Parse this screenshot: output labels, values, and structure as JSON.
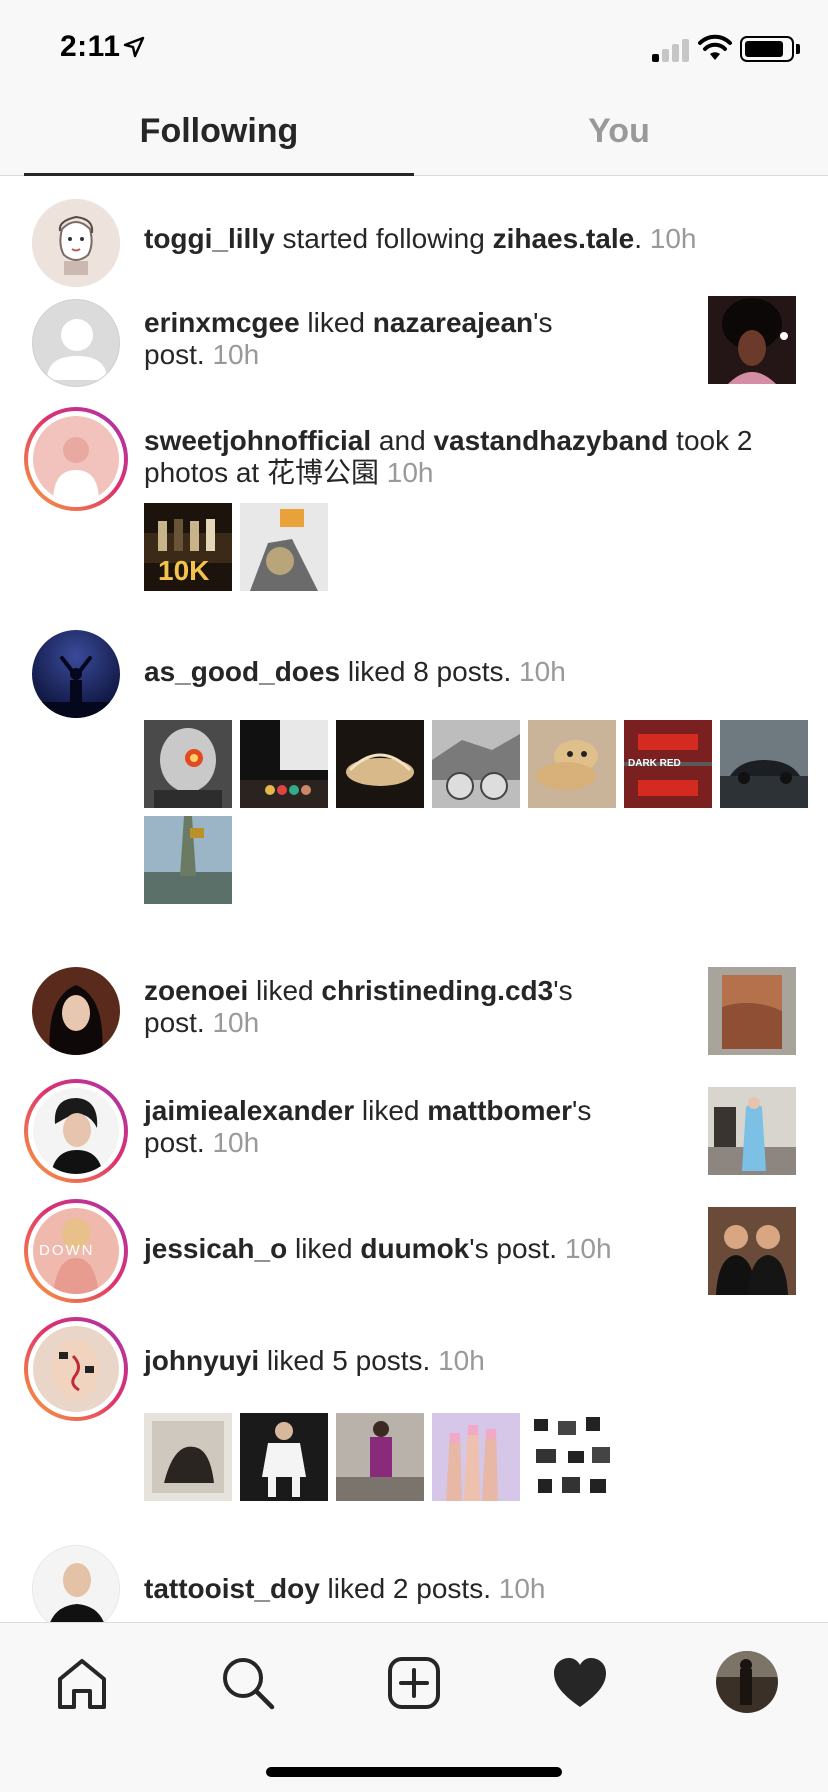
{
  "status_bar": {
    "time": "2:11",
    "icons": [
      "location-arrow-icon",
      "cellular-signal-icon",
      "wifi-icon",
      "battery-icon"
    ],
    "signal_bars_active": 1,
    "signal_bars_total": 4
  },
  "tabs": {
    "following": "Following",
    "you": "You",
    "active": "following",
    "active_color": "#262626",
    "inactive_color": "#999999"
  },
  "feed": [
    {
      "avatar_icon": "avatar-sketch",
      "ring": false,
      "user": "toggi_lilly",
      "action": " started following ",
      "target": "zihaes.tale",
      "suffix": ".",
      "time": "10h"
    },
    {
      "avatar_icon": "avatar-placeholder-icon",
      "ring": false,
      "user": "erinxmcgee",
      "action": " liked ",
      "target": "nazareajean",
      "suffix": "'s",
      "line2": "post.",
      "time": "10h",
      "thumb": "liked-post-thumbnail"
    },
    {
      "avatar_icon": "avatar-photo",
      "ring": true,
      "user": "sweetjohnofficial",
      "action": " and ",
      "target": "vastandhazyband",
      "suffix": " took 2",
      "line2": "photos at 花博公園",
      "time": "10h",
      "photos_count": 2,
      "photo_badge": "10K"
    },
    {
      "avatar_icon": "avatar-silhouette",
      "ring": false,
      "user": "as_good_does",
      "action": " liked 8 posts.",
      "time": "10h",
      "photos_count": 8,
      "photo_caption": "DARK RED"
    },
    {
      "avatar_icon": "avatar-photo",
      "ring": false,
      "user": "zoenoei",
      "action": " liked ",
      "target": "christineding.cd3",
      "suffix": "'s",
      "line2": "post.",
      "time": "10h",
      "thumb": "liked-post-thumbnail"
    },
    {
      "avatar_icon": "avatar-photo",
      "ring": true,
      "user": "jaimiealexander",
      "action": " liked ",
      "target": "mattbomer",
      "suffix": "'s",
      "line2": "post.",
      "time": "10h",
      "thumb": "liked-post-thumbnail"
    },
    {
      "avatar_icon": "avatar-photo",
      "ring": true,
      "user": "jessicah_o",
      "action": " liked ",
      "target": "duumok",
      "suffix": "'s post.",
      "time": "10h",
      "thumb": "liked-post-thumbnail",
      "avatar_text": "DOWN"
    },
    {
      "avatar_icon": "avatar-photo",
      "ring": true,
      "user": "johnyuyi",
      "action": " liked 5 posts.",
      "time": "10h",
      "photos_count": 5
    },
    {
      "avatar_icon": "avatar-photo",
      "ring": false,
      "user": "tattooist_doy",
      "action": " liked 2 posts.",
      "time": "10h"
    }
  ],
  "bottom_nav": {
    "items": [
      "home-icon",
      "search-icon",
      "new-post-icon",
      "activity-heart-icon",
      "profile-avatar-icon"
    ],
    "active": "activity-heart-icon"
  },
  "colors": {
    "story_ring_start": "#f9a23a",
    "story_ring_mid": "#e1306c",
    "story_ring_end": "#a233b5",
    "text": "#262626",
    "muted": "#999999"
  }
}
